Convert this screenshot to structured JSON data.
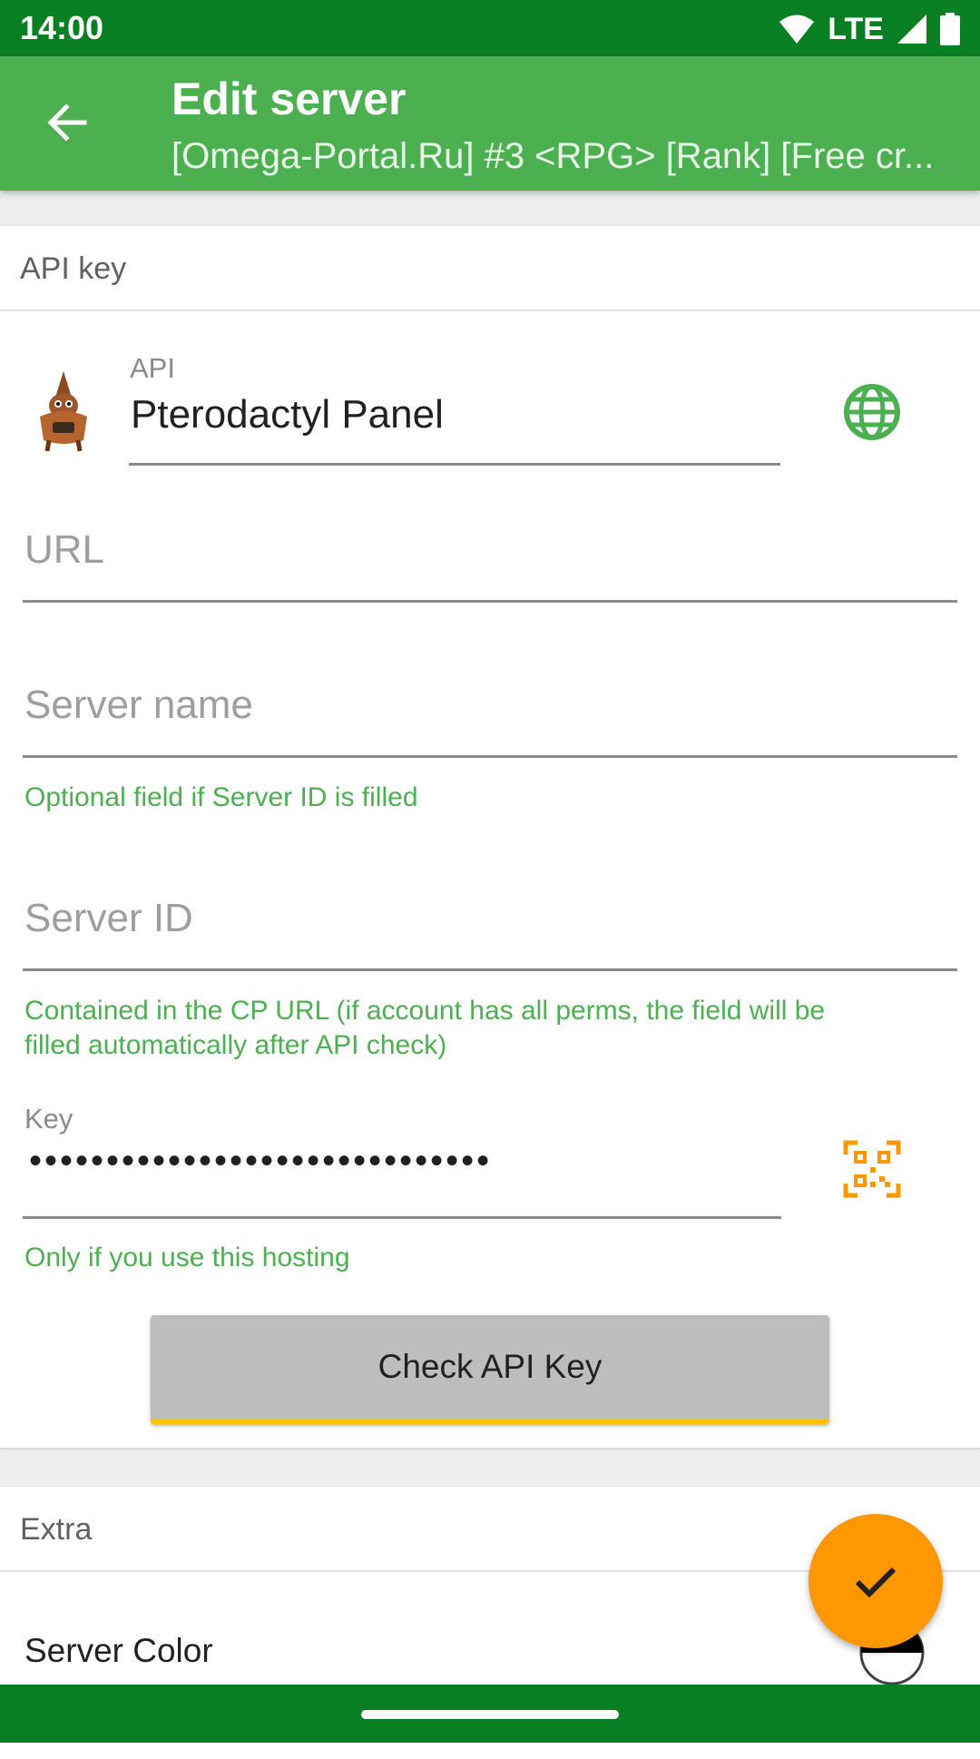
{
  "status_bar": {
    "time": "14:00",
    "network": "LTE"
  },
  "app_bar": {
    "title": "Edit server",
    "subtitle": "[Omega-Portal.Ru] #3 <RPG> [Rank] [Free cr..."
  },
  "api_section": {
    "header": "API key",
    "api_label": "API",
    "api_value": "Pterodactyl Panel",
    "url_placeholder": "URL",
    "server_name_placeholder": "Server name",
    "server_name_helper": "Optional field if Server ID is filled",
    "server_id_placeholder": "Server ID",
    "server_id_helper_line1": "Contained in the CP URL (if account has all perms, the field will be",
    "server_id_helper_line2": "filled automatically after API check)",
    "key_label": "Key",
    "key_value": "••••••••••••••••••••••••••••••",
    "key_helper": "Only if you use this hosting",
    "check_button": "Check API Key"
  },
  "extra_section": {
    "header": "Extra",
    "server_color_label": "Server Color"
  },
  "colors": {
    "status_bar": "#087f23",
    "app_bar": "#4caf50",
    "accent": "#ff9800",
    "helper_text": "#4caf50"
  },
  "icons": {
    "back": "arrow-left-icon",
    "globe": "globe-icon",
    "qr": "qr-code-icon",
    "fab": "check-icon",
    "logo": "pterodactyl-logo"
  }
}
